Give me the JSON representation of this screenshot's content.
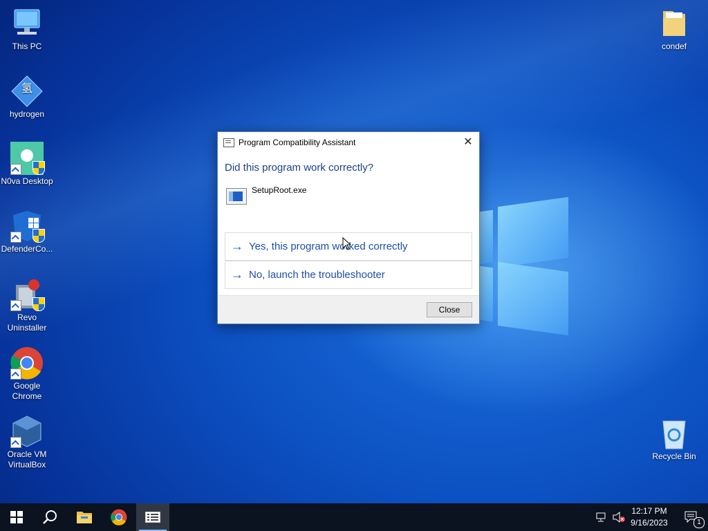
{
  "desktop": {
    "icons_left": [
      {
        "label": "This PC"
      },
      {
        "label": "hydrogen",
        "glyph": "氢"
      },
      {
        "label": "N0va Desktop"
      },
      {
        "label": "DefenderCo..."
      },
      {
        "label": "Revo Uninstaller"
      },
      {
        "label": "Google Chrome"
      },
      {
        "label": "Oracle VM VirtualBox"
      }
    ],
    "icons_right": [
      {
        "label": "condef"
      },
      {
        "label": "Recycle Bin"
      }
    ]
  },
  "dialog": {
    "title": "Program Compatibility Assistant",
    "close_glyph": "✕",
    "question": "Did this program work correctly?",
    "program_name": "SetupRoot.exe",
    "options": [
      {
        "arrow": "→",
        "label": "Yes, this program worked correctly"
      },
      {
        "arrow": "→",
        "label": "No, launch the troubleshooter"
      }
    ],
    "close_button": "Close"
  },
  "taskbar": {
    "clock_time": "12:17 PM",
    "clock_date": "9/16/2023",
    "notification_count": "1",
    "icons": [
      "windows-start-icon",
      "search-icon",
      "file-explorer-icon",
      "chrome-icon",
      "compatibility-assistant-icon"
    ]
  },
  "colors": {
    "dialog_heading": "#1c3e8c",
    "option_link": "#1c4ea8",
    "taskbar_bg": "#0b1220"
  }
}
